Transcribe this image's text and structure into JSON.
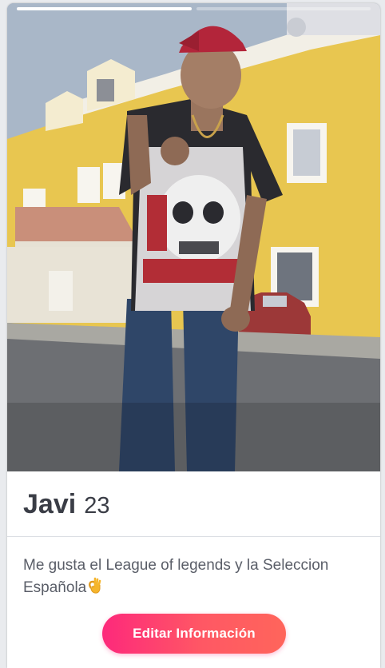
{
  "profile": {
    "name": "Javi",
    "age": "23",
    "bio_text": "Me gusta el League of legends y la Seleccion Española",
    "bio_emoji": "ok-hand-icon"
  },
  "photo": {
    "count": 2,
    "active_index": 0,
    "description_icon": "profile-photo"
  },
  "actions": {
    "edit_label": "Editar Información"
  },
  "colors": {
    "button_gradient_start": "#fd297b",
    "button_gradient_end": "#ff655b",
    "text_primary": "#3a3d46",
    "text_secondary": "#5a5e68"
  }
}
